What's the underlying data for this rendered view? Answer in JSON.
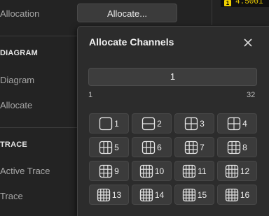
{
  "settings": {
    "allocation_label": "Allocation",
    "allocate_button": "Allocate...",
    "diagram_section": "DIAGRAM",
    "diagram_label": "Diagram",
    "allocate_label": "Allocate",
    "trace_section": "TRACE",
    "active_trace_label": "Active Trace",
    "trace_label": "Trace"
  },
  "status": {
    "marker": "1",
    "readout": "4.5001"
  },
  "dialog": {
    "title": "Allocate Channels",
    "channels_value": "1",
    "range_min": "1",
    "range_max": "32",
    "options": [
      {
        "label": "1",
        "layout": [
          1,
          1
        ]
      },
      {
        "label": "2",
        "layout": [
          1,
          2
        ]
      },
      {
        "label": "3",
        "layout": [
          2,
          2
        ]
      },
      {
        "label": "4",
        "layout": [
          2,
          2
        ]
      },
      {
        "label": "5",
        "layout": [
          3,
          2
        ]
      },
      {
        "label": "6",
        "layout": [
          3,
          2
        ]
      },
      {
        "label": "7",
        "layout": [
          3,
          3
        ]
      },
      {
        "label": "8",
        "layout": [
          3,
          3
        ]
      },
      {
        "label": "9",
        "layout": [
          3,
          3
        ]
      },
      {
        "label": "10",
        "layout": [
          4,
          3
        ]
      },
      {
        "label": "11",
        "layout": [
          4,
          3
        ]
      },
      {
        "label": "12",
        "layout": [
          4,
          3
        ]
      },
      {
        "label": "13",
        "layout": [
          4,
          4
        ]
      },
      {
        "label": "14",
        "layout": [
          4,
          4
        ]
      },
      {
        "label": "15",
        "layout": [
          4,
          4
        ]
      },
      {
        "label": "16",
        "layout": [
          4,
          4
        ]
      }
    ]
  }
}
